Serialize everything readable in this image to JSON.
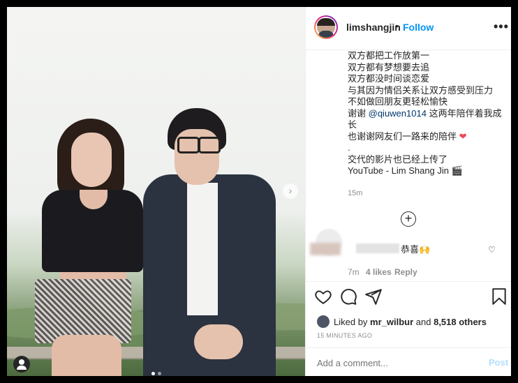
{
  "post": {
    "username": "limshangjin",
    "separator": "•",
    "follow_label": "Follow",
    "more_label": "•••"
  },
  "caption": {
    "lines": [
      "双方都把工作放第一",
      "双方都有梦想要去追",
      "双方都没时间谈恋爱",
      "与其因为情侣关系让双方感受到压力",
      "不如做回朋友更轻松愉快"
    ],
    "thanks_prefix": "谢谢 ",
    "mention": "@qiuwen1014",
    "thanks_suffix": " 这两年陪伴着我成长",
    "netizens": "也谢谢网友们一路来的陪伴",
    "heart_emoji": "❤",
    "dot_line": ".",
    "video_line": "交代的影片也已经上传了",
    "youtube_line": "YouTube - Lim Shang Jin 🎬",
    "time": "15m"
  },
  "load_more": "+",
  "comment": {
    "text": "恭喜🙌",
    "time": "7m",
    "likes": "4 likes",
    "reply": "Reply",
    "heart": "♡"
  },
  "likes": {
    "prefix": "Liked by ",
    "user": "mr_wilbur",
    "middle": " and ",
    "others": "8,518 others"
  },
  "timestamp": "15 MINUTES AGO",
  "comment_box": {
    "placeholder": "Add a comment...",
    "post_label": "Post"
  },
  "carousel": {
    "next_label": "›"
  },
  "colors": {
    "accent": "#0095f6",
    "heart": "#ed4956",
    "post_disabled": "#b2dffc"
  }
}
